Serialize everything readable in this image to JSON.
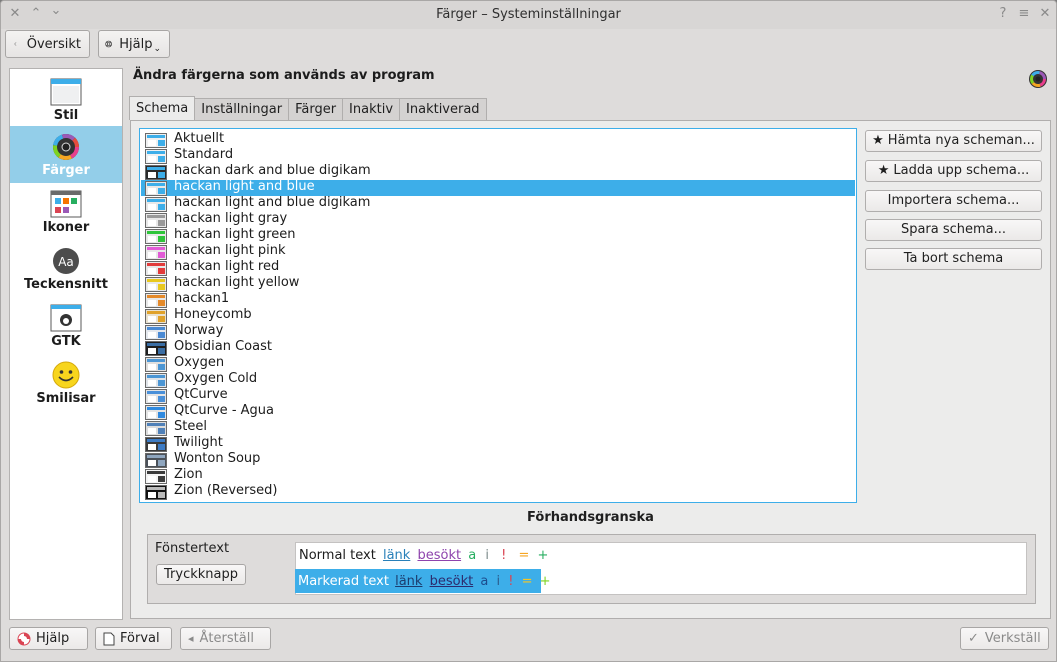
{
  "window": {
    "title": "Färger – Systeminställningar"
  },
  "titlebar_buttons": {
    "close": "✕",
    "up": "⌃",
    "down": "⌄",
    "help": "?",
    "menu": "≡",
    "pin": "✕"
  },
  "toolbar": {
    "overview_label": "Översikt",
    "help_label": "Hjälp"
  },
  "sidebar": {
    "items": [
      {
        "label": "Stil",
        "icon": "window-style-icon",
        "selected": false
      },
      {
        "label": "Färger",
        "icon": "color-wheel-icon",
        "selected": true
      },
      {
        "label": "Ikoner",
        "icon": "icons-icon",
        "selected": false
      },
      {
        "label": "Teckensnitt",
        "icon": "font-icon",
        "selected": false
      },
      {
        "label": "GTK",
        "icon": "gtk-icon",
        "selected": false
      },
      {
        "label": "Smilisar",
        "icon": "smiley-icon",
        "selected": false
      }
    ]
  },
  "main": {
    "heading": "Ändra färgerna som används av program",
    "tabs": [
      {
        "label": "Schema",
        "active": true
      },
      {
        "label": "Inställningar",
        "active": false
      },
      {
        "label": "Färger",
        "active": false
      },
      {
        "label": "Inaktiv",
        "active": false
      },
      {
        "label": "Inaktiverad",
        "active": false
      }
    ],
    "schemes": [
      {
        "name": "Aktuellt",
        "bg": "#eff0f1",
        "accent": "#3daee9"
      },
      {
        "name": "Standard",
        "bg": "#eff0f1",
        "accent": "#3daee9"
      },
      {
        "name": "hackan dark and blue digikam",
        "bg": "#2b2b2b",
        "accent": "#3daee9"
      },
      {
        "name": "hackan light and blue",
        "bg": "#e8e8e8",
        "accent": "#3daee9",
        "selected": true
      },
      {
        "name": "hackan light and blue digikam",
        "bg": "#e8e8e8",
        "accent": "#3daee9"
      },
      {
        "name": "hackan light gray",
        "bg": "#e8e8e8",
        "accent": "#9a9a9a"
      },
      {
        "name": "hackan light green",
        "bg": "#e8e8e8",
        "accent": "#2ec43a"
      },
      {
        "name": "hackan light pink",
        "bg": "#e8e8e8",
        "accent": "#e25bd6"
      },
      {
        "name": "hackan light red",
        "bg": "#e8e8e8",
        "accent": "#e23b3b"
      },
      {
        "name": "hackan light yellow",
        "bg": "#e8e8e8",
        "accent": "#e8c81f"
      },
      {
        "name": "hackan1",
        "bg": "#e8e8e8",
        "accent": "#e58a2a"
      },
      {
        "name": "Honeycomb",
        "bg": "#e9e1cf",
        "accent": "#e0a22a"
      },
      {
        "name": "Norway",
        "bg": "#e4e8ee",
        "accent": "#4a8ad4"
      },
      {
        "name": "Obsidian Coast",
        "bg": "#1e1e1e",
        "accent": "#3a6ea5"
      },
      {
        "name": "Oxygen",
        "bg": "#e0dfde",
        "accent": "#4c96d4"
      },
      {
        "name": "Oxygen Cold",
        "bg": "#dfe3e8",
        "accent": "#4c96d4"
      },
      {
        "name": "QtCurve",
        "bg": "#e4e4e4",
        "accent": "#4a90d9"
      },
      {
        "name": "QtCurve - Agua",
        "bg": "#e4e4e4",
        "accent": "#2f8ae0"
      },
      {
        "name": "Steel",
        "bg": "#dcdcdc",
        "accent": "#4f80b8"
      },
      {
        "name": "Twilight",
        "bg": "#3a3a3a",
        "accent": "#3d7bc4"
      },
      {
        "name": "Wonton Soup",
        "bg": "#4b5159",
        "accent": "#8fa6bf"
      },
      {
        "name": "Zion",
        "bg": "#f4f4f4",
        "accent": "#3b3b3b"
      },
      {
        "name": "Zion (Reversed)",
        "bg": "#111111",
        "accent": "#bbbbbb"
      }
    ],
    "side_buttons": {
      "get_new": "Hämta nya scheman...",
      "upload": "Ladda upp schema...",
      "import": "Importera schema...",
      "save": "Spara schema...",
      "remove": "Ta bort schema"
    },
    "preview": {
      "title": "Förhandsgranska",
      "window_text": "Fönstertext",
      "push_button": "Tryckknapp",
      "normal_text": "Normal text",
      "selected_text": "Markerad text",
      "link": "länk",
      "visited": "besökt",
      "a": "a",
      "i": "i",
      "excl": "!",
      "eq": "=",
      "plus": "+"
    }
  },
  "footer": {
    "help": "Hjälp",
    "defaults": "Förval",
    "reset": "Återställ",
    "apply": "Verkställ"
  },
  "colors": {
    "accent": "#3daee9",
    "link": "#2980b9",
    "visited": "#7f8c8d",
    "positive": "#27ae60",
    "neutral": "#f67400",
    "negative": "#da4453"
  }
}
